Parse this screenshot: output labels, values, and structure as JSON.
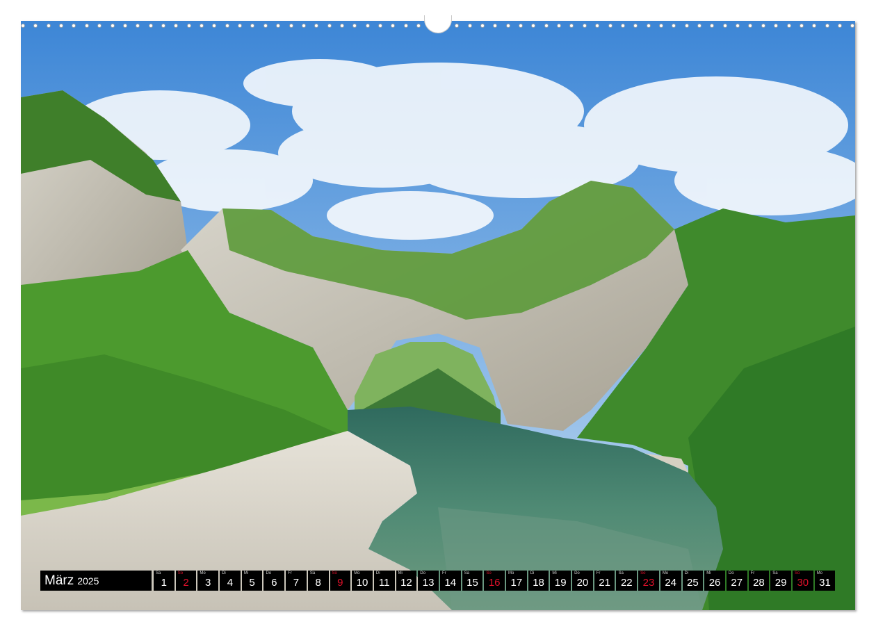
{
  "calendar": {
    "month": "März",
    "year": "2025",
    "days": [
      {
        "wd": "Sa",
        "n": "1",
        "sun": false
      },
      {
        "wd": "So",
        "n": "2",
        "sun": true
      },
      {
        "wd": "Mo",
        "n": "3",
        "sun": false
      },
      {
        "wd": "Di",
        "n": "4",
        "sun": false
      },
      {
        "wd": "Mi",
        "n": "5",
        "sun": false
      },
      {
        "wd": "Do",
        "n": "6",
        "sun": false
      },
      {
        "wd": "Fr",
        "n": "7",
        "sun": false
      },
      {
        "wd": "Sa",
        "n": "8",
        "sun": false
      },
      {
        "wd": "So",
        "n": "9",
        "sun": true
      },
      {
        "wd": "Mo",
        "n": "10",
        "sun": false
      },
      {
        "wd": "Di",
        "n": "11",
        "sun": false
      },
      {
        "wd": "Mi",
        "n": "12",
        "sun": false
      },
      {
        "wd": "Do",
        "n": "13",
        "sun": false
      },
      {
        "wd": "Fr",
        "n": "14",
        "sun": false
      },
      {
        "wd": "Sa",
        "n": "15",
        "sun": false
      },
      {
        "wd": "So",
        "n": "16",
        "sun": true
      },
      {
        "wd": "Mo",
        "n": "17",
        "sun": false
      },
      {
        "wd": "Di",
        "n": "18",
        "sun": false
      },
      {
        "wd": "Mi",
        "n": "19",
        "sun": false
      },
      {
        "wd": "Do",
        "n": "20",
        "sun": false
      },
      {
        "wd": "Fr",
        "n": "21",
        "sun": false
      },
      {
        "wd": "Sa",
        "n": "22",
        "sun": false
      },
      {
        "wd": "So",
        "n": "23",
        "sun": true
      },
      {
        "wd": "Mo",
        "n": "24",
        "sun": false
      },
      {
        "wd": "Di",
        "n": "25",
        "sun": false
      },
      {
        "wd": "Mi",
        "n": "26",
        "sun": false
      },
      {
        "wd": "Do",
        "n": "27",
        "sun": false
      },
      {
        "wd": "Fr",
        "n": "28",
        "sun": false
      },
      {
        "wd": "Sa",
        "n": "29",
        "sun": false
      },
      {
        "wd": "So",
        "n": "30",
        "sun": true
      },
      {
        "wd": "Mo",
        "n": "31",
        "sun": false
      }
    ]
  },
  "colors": {
    "sunday": "#e0102a",
    "bar_background": "#000000",
    "sky": "#4a8fd8",
    "foliage": "#4f9a2c",
    "river": "#3f7a6a",
    "gravel": "#d8d3c7"
  }
}
